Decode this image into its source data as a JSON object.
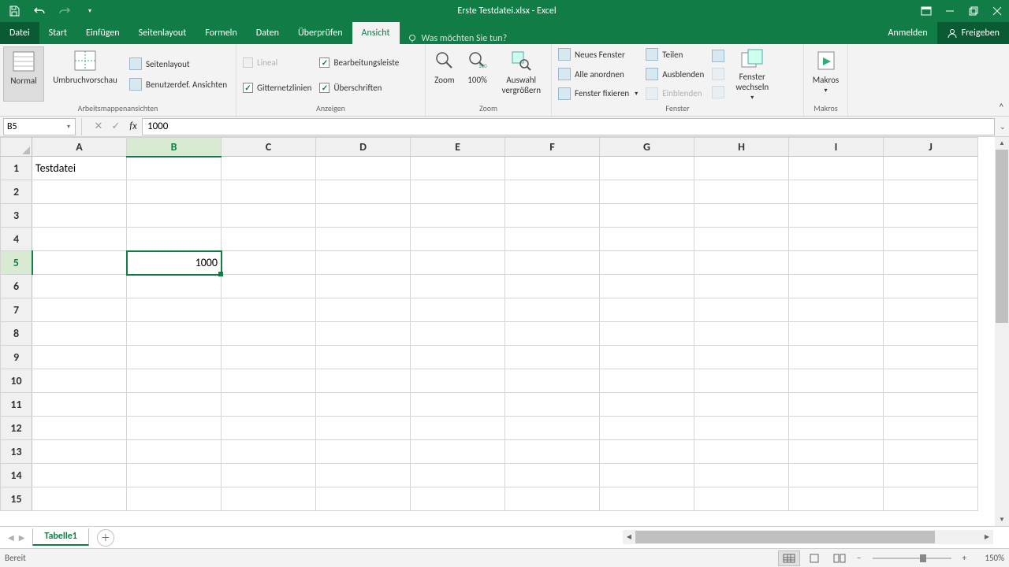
{
  "title": "Erste Testdatei.xlsx - Excel",
  "tabs": {
    "file": "Datei",
    "items": [
      "Start",
      "Einfügen",
      "Seitenlayout",
      "Formeln",
      "Daten",
      "Überprüfen",
      "Ansicht"
    ],
    "active_index": 6,
    "tellme": "Was möchten Sie tun?",
    "signin": "Anmelden",
    "share": "Freigeben"
  },
  "ribbon": {
    "group_views": {
      "label": "Arbeitsmappenansichten",
      "normal": "Normal",
      "pagebreak": "Umbruchvorschau",
      "pagelayout": "Seitenlayout",
      "custom": "Benutzerdef. Ansichten"
    },
    "group_show": {
      "label": "Anzeigen",
      "ruler": "Lineal",
      "gridlines": "Gitternetzlinien",
      "formulabar": "Bearbeitungsleiste",
      "headings": "Überschriften"
    },
    "group_zoom": {
      "label": "Zoom",
      "zoom": "Zoom",
      "z100": "100%",
      "zoomselect": "Auswahl vergrößern"
    },
    "group_window": {
      "label": "Fenster",
      "newwin": "Neues Fenster",
      "arrange": "Alle anordnen",
      "freeze": "Fenster fixieren",
      "split": "Teilen",
      "hide": "Ausblenden",
      "unhide": "Einblenden",
      "switch": "Fenster wechseln"
    },
    "group_macros": {
      "label": "Makros",
      "macros": "Makros"
    }
  },
  "namebox": "B5",
  "formula": "1000",
  "columns": [
    "A",
    "B",
    "C",
    "D",
    "E",
    "F",
    "G",
    "H",
    "I",
    "J"
  ],
  "rowcount": 15,
  "selected": {
    "row": 5,
    "col": 1
  },
  "cells": {
    "A1": "Testdatei",
    "B5": "1000"
  },
  "sheet": {
    "name": "Tabelle1"
  },
  "status": {
    "ready": "Bereit",
    "zoom": "150%"
  }
}
